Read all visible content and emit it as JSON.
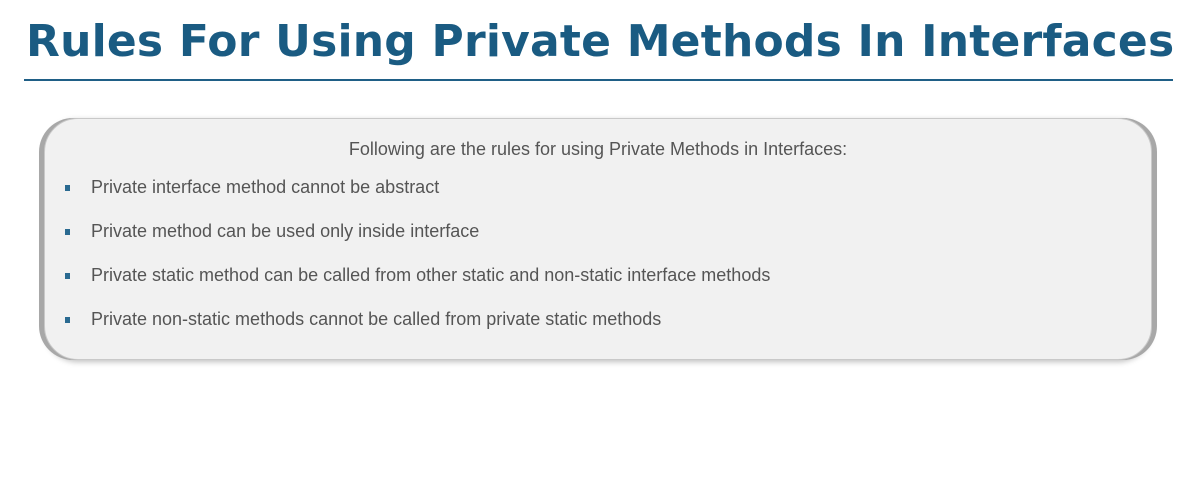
{
  "slide": {
    "title": "Rules For Using Private Methods In Interfaces",
    "intro": "Following are the rules for using Private Methods in Interfaces:",
    "rules": [
      "Private interface method cannot be abstract",
      "Private method can be used only inside interface",
      "Private static method can be called from other static and non-static interface methods",
      "Private non-static methods cannot be called from private static methods"
    ]
  },
  "colors": {
    "title": "#1a5b82",
    "bullet": "#2a6a91",
    "body_text": "#555555",
    "box_background": "#f1f1f1"
  }
}
